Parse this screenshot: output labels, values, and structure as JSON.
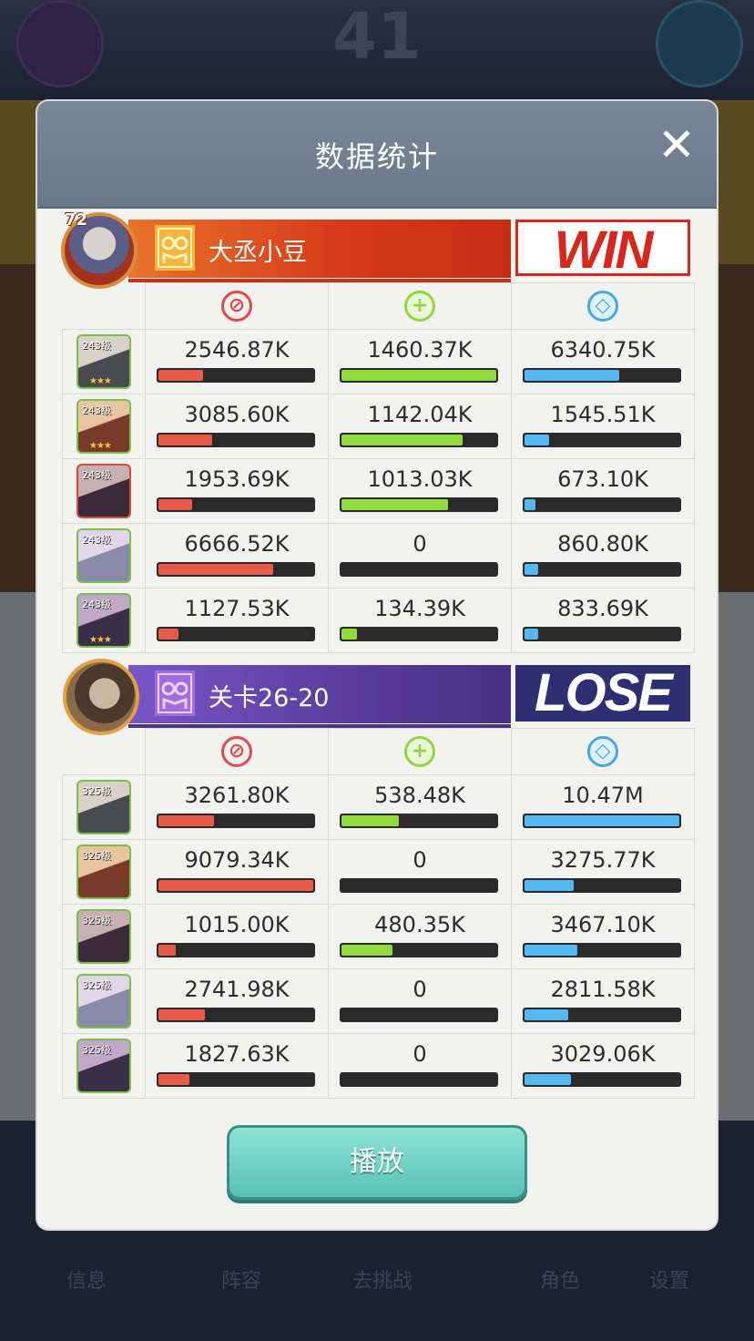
{
  "background": {
    "score": "41",
    "tabs": [
      "信息",
      "阵容",
      "去挑战",
      "角色",
      "设置"
    ]
  },
  "modal": {
    "title": "数据统计",
    "close_icon": "close-icon",
    "play_label": "播放"
  },
  "teams": [
    {
      "name": "大丞小豆",
      "result": "WIN",
      "level": "72",
      "flag_color": "#f4b73a",
      "heroes": [
        {
          "level": "243级",
          "stars": "★★★",
          "attack": "2546.87K",
          "attack_pct": 0.29,
          "heal": "1460.37K",
          "heal_pct": 1.0,
          "defense": "6340.75K",
          "defense_pct": 0.61
        },
        {
          "level": "243级",
          "stars": "★★★",
          "attack": "3085.60K",
          "attack_pct": 0.35,
          "heal": "1142.04K",
          "heal_pct": 0.78,
          "defense": "1545.51K",
          "defense_pct": 0.16
        },
        {
          "level": "243级",
          "stars": "",
          "attack": "1953.69K",
          "attack_pct": 0.22,
          "heal": "1013.03K",
          "heal_pct": 0.69,
          "defense": "673.10K",
          "defense_pct": 0.07
        },
        {
          "level": "243级",
          "stars": "",
          "attack": "6666.52K",
          "attack_pct": 0.74,
          "heal": "0",
          "heal_pct": 0,
          "defense": "860.80K",
          "defense_pct": 0.09
        },
        {
          "level": "243级",
          "stars": "★★★",
          "attack": "1127.53K",
          "attack_pct": 0.13,
          "heal": "134.39K",
          "heal_pct": 0.1,
          "defense": "833.69K",
          "defense_pct": 0.09
        }
      ]
    },
    {
      "name": "关卡26-20",
      "result": "LOSE",
      "flag_color": "#a26be0",
      "heroes": [
        {
          "level": "325级",
          "stars": "",
          "attack": "3261.80K",
          "attack_pct": 0.36,
          "heal": "538.48K",
          "heal_pct": 0.37,
          "defense": "10.47M",
          "defense_pct": 1.0
        },
        {
          "level": "325级",
          "stars": "",
          "attack": "9079.34K",
          "attack_pct": 1.0,
          "heal": "0",
          "heal_pct": 0,
          "defense": "3275.77K",
          "defense_pct": 0.32
        },
        {
          "level": "325级",
          "stars": "",
          "attack": "1015.00K",
          "attack_pct": 0.11,
          "heal": "480.35K",
          "heal_pct": 0.33,
          "defense": "3467.10K",
          "defense_pct": 0.34
        },
        {
          "level": "325级",
          "stars": "",
          "attack": "2741.98K",
          "attack_pct": 0.3,
          "heal": "0",
          "heal_pct": 0,
          "defense": "2811.58K",
          "defense_pct": 0.28
        },
        {
          "level": "325级",
          "stars": "",
          "attack": "1827.63K",
          "attack_pct": 0.2,
          "heal": "0",
          "heal_pct": 0,
          "defense": "3029.06K",
          "defense_pct": 0.3
        }
      ]
    }
  ],
  "stat_icons": [
    "attack-icon",
    "heal-icon",
    "defense-icon"
  ]
}
